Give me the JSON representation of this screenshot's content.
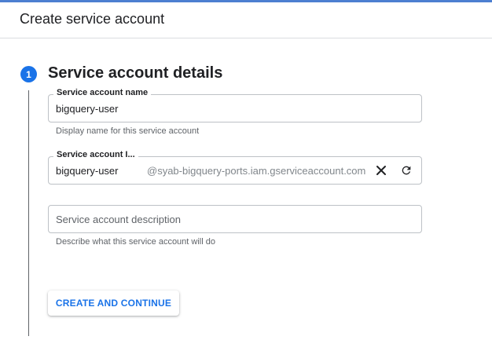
{
  "header": {
    "title": "Create service account"
  },
  "step": {
    "number": "1",
    "title": "Service account details"
  },
  "fields": {
    "name": {
      "label": "Service account name",
      "value": "bigquery-user",
      "hint": "Display name for this service account"
    },
    "id": {
      "label": "Service account I...",
      "value": "bigquery-user",
      "suffix": "@syab-bigquery-ports.iam.gserviceaccount.com",
      "clear_icon": "close-icon",
      "refresh_icon": "refresh-icon"
    },
    "description": {
      "placeholder": "Service account description",
      "hint": "Describe what this service account will do"
    }
  },
  "actions": {
    "create_label": "CREATE AND CONTINUE"
  },
  "colors": {
    "accent": "#1a73e8",
    "top_line": "#4d7fd1",
    "border": "#bdc1c6",
    "hint_text": "#5f6368"
  }
}
